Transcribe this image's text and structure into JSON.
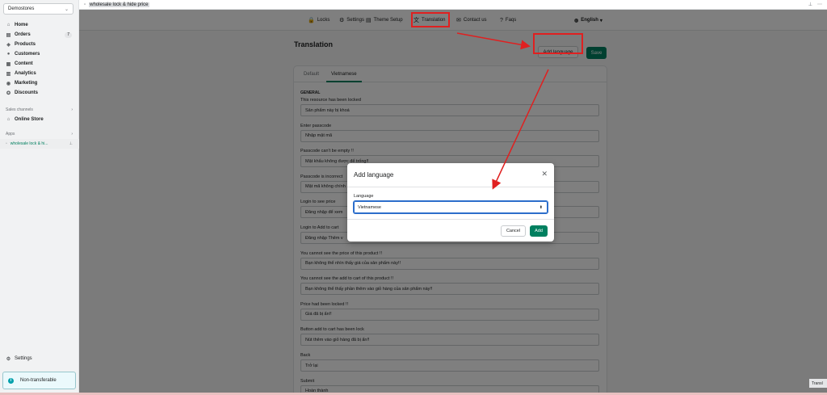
{
  "sidebar": {
    "store_name": "Demostores",
    "nav": [
      {
        "label": "Home",
        "icon": "home-icon",
        "glyph": "⌂"
      },
      {
        "label": "Orders",
        "icon": "orders-icon",
        "glyph": "▤",
        "badge": "7"
      },
      {
        "label": "Products",
        "icon": "tag-icon",
        "glyph": "◈"
      },
      {
        "label": "Customers",
        "icon": "customer-icon",
        "glyph": "●"
      },
      {
        "label": "Content",
        "icon": "content-icon",
        "glyph": "▦"
      },
      {
        "label": "Analytics",
        "icon": "analytics-icon",
        "glyph": "▥"
      },
      {
        "label": "Marketing",
        "icon": "marketing-icon",
        "glyph": "◉"
      },
      {
        "label": "Discounts",
        "icon": "discount-icon",
        "glyph": "✪"
      }
    ],
    "sales_channels_label": "Sales channels",
    "online_store_label": "Online Store",
    "apps_label": "Apps",
    "app_item_label": "wholesale lock & hi...",
    "settings_label": "Settings",
    "nontransferable_label": "Non-transferable"
  },
  "appbar": {
    "title": "wholesale lock & hide price"
  },
  "top_tabs": [
    {
      "label": "Locks",
      "icon": "lock-icon",
      "glyph": "🔒"
    },
    {
      "label": "Settings",
      "icon": "gear-icon",
      "glyph": "⚙"
    },
    {
      "label": "Theme Setup",
      "icon": "theme-icon",
      "glyph": "▤"
    },
    {
      "label": "Translation",
      "icon": "translate-icon",
      "glyph": "文"
    },
    {
      "label": "Contact us",
      "icon": "email-icon",
      "glyph": "✉"
    },
    {
      "label": "Faqs",
      "icon": "help-icon",
      "glyph": "?"
    }
  ],
  "language_selector": {
    "label": "English",
    "icon": "globe-icon"
  },
  "page": {
    "title": "Translation",
    "add_language_label": "Add language",
    "save_label": "Save",
    "tabs": [
      "Default",
      "Vietnamese"
    ],
    "section": "GENERAL",
    "fields": [
      {
        "label": "This resource has been locked",
        "value": "Sản phẩm này bị khoá"
      },
      {
        "label": "Enter passcode",
        "value": "Nhập mật mã"
      },
      {
        "label": "Passcode can't be empty !!",
        "value": "Mật khẩu không được để trống!!"
      },
      {
        "label": "Passcode is incorrect",
        "value": "Mật mã không chính"
      },
      {
        "label": "Login to see price",
        "value": "Đăng nhập để xem"
      },
      {
        "label": "Login to Add to cart",
        "value": "Đăng nhập Thêm v"
      },
      {
        "label": "You cannot see the price of this product !!",
        "value": "Bạn không thể nhìn thấy giá của sản phẩm này!!"
      },
      {
        "label": "You cannot see the add to cart of this product !!",
        "value": "Bạn không thể thấy phần thêm vào giỏ hàng của sản phẩm này!!"
      },
      {
        "label": "Price had been locked !!",
        "value": "Giá đã bị ẩn!!"
      },
      {
        "label": "Button add to cart has been lock",
        "value": "Nút thêm vào giỏ hàng đã bị ẩn!!"
      },
      {
        "label": "Back",
        "value": "Trở lại"
      },
      {
        "label": "Submit",
        "value": "Hoàn thành"
      }
    ]
  },
  "modal": {
    "title": "Add language",
    "field_label": "Language",
    "selected": "Vietnamese",
    "cancel_label": "Cancel",
    "add_label": "Add"
  },
  "corner_tag": "Transl",
  "colors": {
    "primary": "#008060",
    "annotation": "#e02020",
    "focus": "#2c6ecb"
  }
}
